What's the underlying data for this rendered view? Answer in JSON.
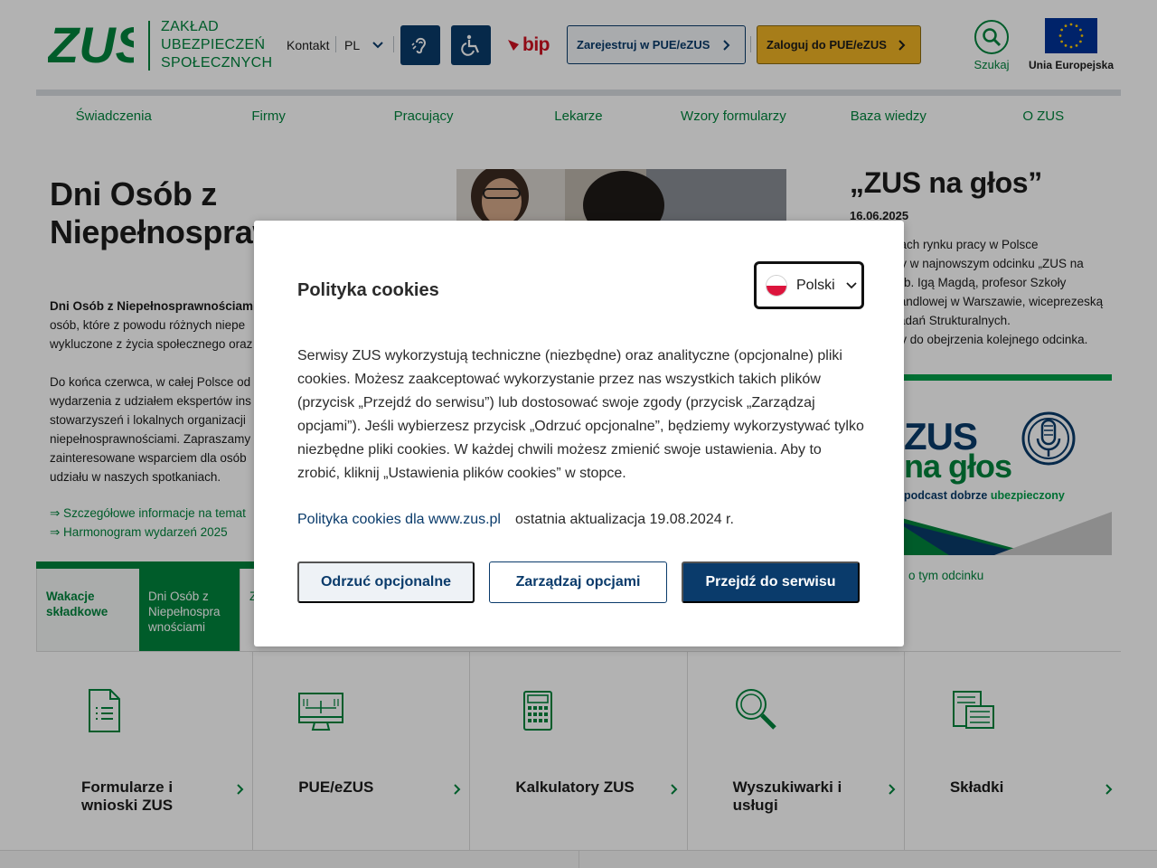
{
  "header": {
    "logo_mark": "ZUS",
    "logo_lines": [
      "ZAKŁAD",
      "UBEZPIECZEŃ",
      "SPOŁECZNYCH"
    ],
    "contact_label": "Kontakt",
    "language_label": "PL",
    "bip_label": "bip",
    "register_label": "Zarejestruj w PUE/eZUS",
    "login_label": "Zaloguj do PUE/eZUS",
    "search_label": "Szukaj",
    "eu_label": "Unia Europejska"
  },
  "nav": [
    "Świadczenia",
    "Firmy",
    "Pracujący",
    "Lekarze",
    "Wzory formularzy",
    "Baza wiedzy",
    "O ZUS"
  ],
  "main": {
    "title_lines": [
      "Dni Osób z",
      "Niepełnospraw"
    ],
    "para1_bold": "Dni Osób z Niepełnosprawnościami",
    "para1_lines": [
      "osób, które z powodu różnych niepe",
      "wykluczone z życia społecznego oraz"
    ],
    "para2_lines": [
      "Do końca czerwca, w całej Polsce od",
      "wydarzenia z udziałem ekspertów ins",
      "stowarzyszeń i lokalnych organizacji",
      "niepełnosprawnościami. Zapraszamy",
      "zainteresowane wsparciem dla osób",
      "udziału w naszych spotkaniach."
    ],
    "link1": "⇒ Szczegółowe informacje na temat",
    "link2": "⇒ Harmonogram wydarzeń 2025"
  },
  "tabs": [
    {
      "label": "Wakacje składkowe"
    },
    {
      "label": "Dni Osób z Niepełnospra wnościami"
    },
    {
      "label": "Z n"
    }
  ],
  "side": {
    "title": "„ZUS na głos”",
    "date": "16.06.2025",
    "text_lines": [
      "niach rynku pracy w Polsce",
      "my w najnowszym odcinku „ZUS na",
      "hab. Igą Magdą, profesor Szkoły",
      "Handlowej w Warszawie, wiceprezeską",
      "Badań Strukturalnych.",
      "my do obejrzenia kolejnego odcinka."
    ],
    "podcast_line1": "ZUS",
    "podcast_line2": "na głos",
    "podcast_sub_start": "podcast dobrze",
    "podcast_sub_end": "ubezpieczony",
    "link": "o tym odcinku"
  },
  "tiles": [
    {
      "label": "Formularze i wnioski ZUS",
      "icon": "document-list-icon"
    },
    {
      "label": "PUE/eZUS",
      "icon": "monitor-icon"
    },
    {
      "label": "Kalkulatory ZUS",
      "icon": "calculator-icon"
    },
    {
      "label": "Wyszukiwarki i usługi",
      "icon": "magnifier-icon"
    },
    {
      "label": "Składki",
      "icon": "documents-stack-icon"
    }
  ],
  "cookie_modal": {
    "title": "Polityka cookies",
    "language": "Polski",
    "body": "Serwisy ZUS wykorzystują techniczne (niezbędne) oraz analityczne (opcjonalne) pliki cookies. Możesz zaakceptować wykorzystanie przez nas wszystkich takich plików (przycisk „Przejdź do serwisu”) lub dostosować swoje zgody (przycisk „Zarządzaj opcjami”). Jeśli wybierzesz przycisk „Odrzuć opcjonalne”, będziemy wykorzystywać tylko niezbędne pliki cookies. W każdej chwili możesz zmienić swoje ustawienia. Aby to zrobić, kliknij „Ustawienia plików cookies” w stopce.",
    "policy_link": "Polityka cookies dla www.zus.pl",
    "updated": "ostatnia aktualizacja 19.08.2024 r.",
    "reject_label": "Odrzuć opcjonalne",
    "manage_label": "Zarządzaj opcjami",
    "accept_label": "Przejdź do serwisu"
  },
  "colors": {
    "brand_green": "#00843d",
    "navy": "#0a3b6b",
    "login_yellow": "#f0b424",
    "bip_red": "#cf1020"
  }
}
